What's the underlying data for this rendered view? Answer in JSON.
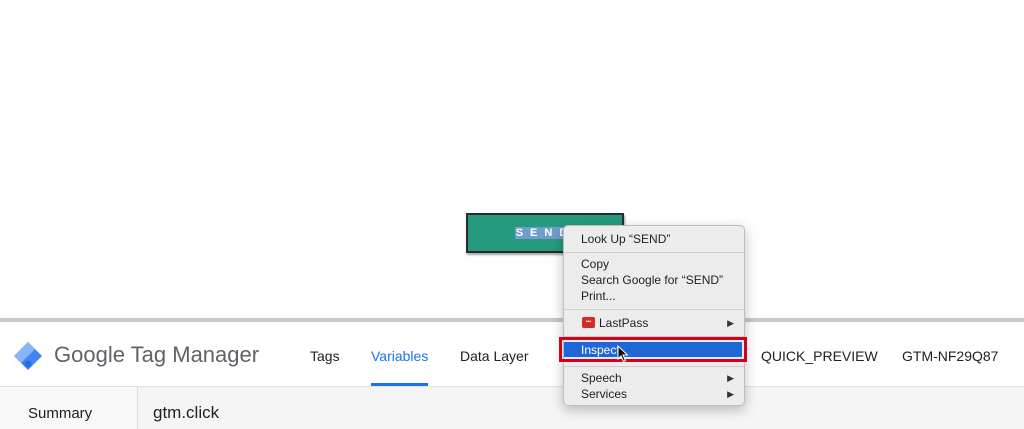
{
  "page": {
    "send_button": {
      "label_highlighted": "SEND",
      "label_rest": ""
    }
  },
  "context_menu": {
    "look_up": "Look Up “SEND”",
    "copy": "Copy",
    "search_google": "Search Google for “SEND”",
    "print": "Print...",
    "lastpass": "LastPass",
    "inspect": "Inspect",
    "speech": "Speech",
    "services": "Services"
  },
  "gtm": {
    "title": "Google Tag Manager",
    "tabs": [
      "Tags",
      "Variables",
      "Data Layer"
    ],
    "active_tab": "Variables",
    "mode": "QUICK_PREVIEW",
    "container_id": "GTM-NF29Q87",
    "summary_label": "Summary",
    "event_name": "gtm.click"
  },
  "colors": {
    "send_button": "#259a7f",
    "gtm_accent": "#1a73e8",
    "highlight_red": "#d0021b",
    "menu_selection": "#1f66d6"
  }
}
